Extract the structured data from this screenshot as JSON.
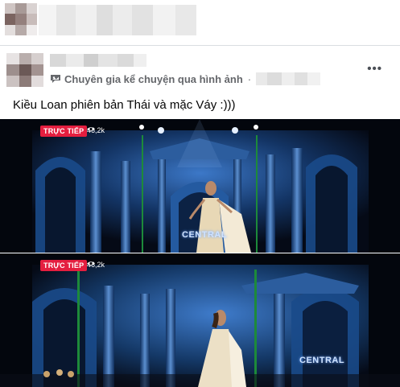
{
  "post": {
    "group_badge": "Chuyên gia kể chuyện qua hình ảnh",
    "badge_separator": "·",
    "more_label": "•••",
    "caption": "Kiều Loan phiên bản Thái và mặc Váy :)))"
  },
  "frames": [
    {
      "live_label": "TRỰC TIẾP",
      "viewer_count": "46,2k",
      "stage_text": "CENTRAL"
    },
    {
      "live_label": "TRỰC TIẾP",
      "viewer_count": "46,2k",
      "stage_text": "CENTRAL"
    }
  ],
  "icons": {
    "badge": "storyteller-badge-icon",
    "viewers": "eye-icon",
    "more": "more-options-icon"
  },
  "colors": {
    "live_badge": "#e41e3f",
    "secondary_text": "#65676b",
    "stage_blue": "#1b4d8f"
  }
}
